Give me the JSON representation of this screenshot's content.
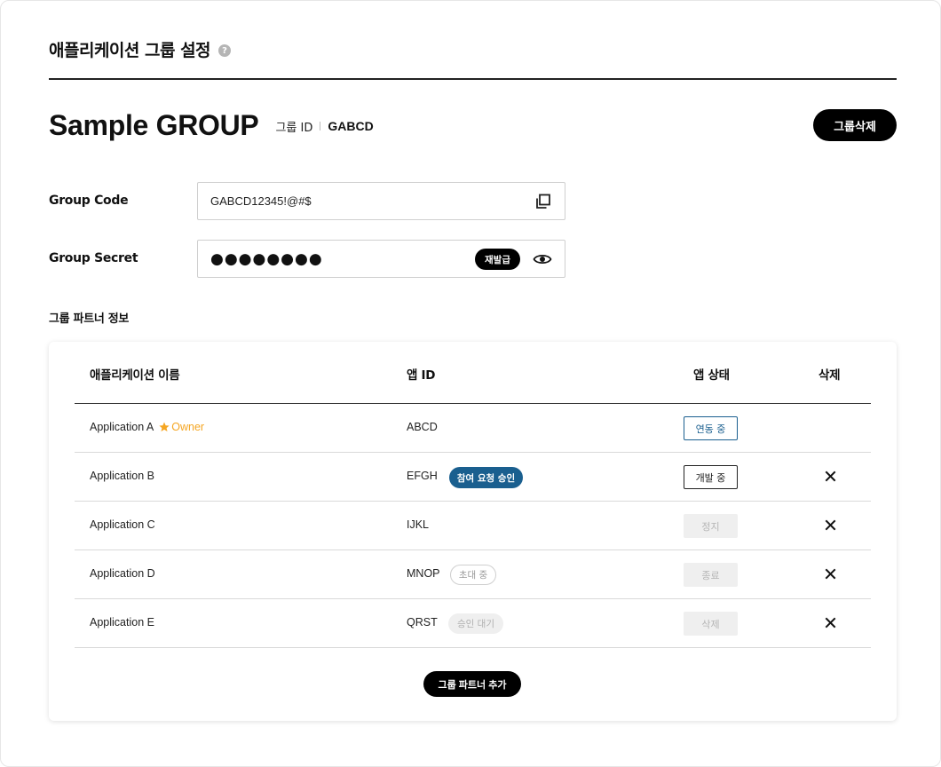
{
  "page": {
    "title": "애플리케이션 그룹 설정",
    "help_icon": "?"
  },
  "group": {
    "name": "Sample GROUP",
    "id_label": "그룹 ID",
    "id_value": "GABCD",
    "delete_label": "그룹삭제"
  },
  "fields": {
    "code_label": "Group Code",
    "code_value": "GABCD12345!@#$",
    "secret_label": "Group Secret",
    "secret_masked": "●●●●●●●●",
    "reissue_label": "재발급"
  },
  "partners": {
    "section_title": "그룹 파트너 정보",
    "columns": [
      "애플리케이션 이름",
      "앱 ID",
      "앱 상태",
      "삭제"
    ],
    "rows": [
      {
        "name": "Application A",
        "owner_label": "Owner",
        "app_id": "ABCD",
        "id_badge": "",
        "status": "연동 중",
        "deletable": false
      },
      {
        "name": "Application B",
        "owner_label": "",
        "app_id": "EFGH",
        "id_badge": "참여 요청 승인",
        "status": "개발 중",
        "deletable": true
      },
      {
        "name": "Application C",
        "owner_label": "",
        "app_id": "IJKL",
        "id_badge": "",
        "status": "정지",
        "deletable": true
      },
      {
        "name": "Application D",
        "owner_label": "",
        "app_id": "MNOP",
        "id_badge": "초대 중",
        "status": "종료",
        "deletable": true
      },
      {
        "name": "Application E",
        "owner_label": "",
        "app_id": "QRST",
        "id_badge": "승인 대기",
        "status": "삭제",
        "deletable": true
      }
    ],
    "add_label": "그룹 파트너 추가"
  },
  "colors": {
    "accent_blue": "#1a5f8f",
    "owner_orange": "#f5a623",
    "black": "#000000"
  },
  "icons": [
    "help-icon",
    "copy-icon",
    "eye-icon",
    "star-icon",
    "close-icon"
  ]
}
